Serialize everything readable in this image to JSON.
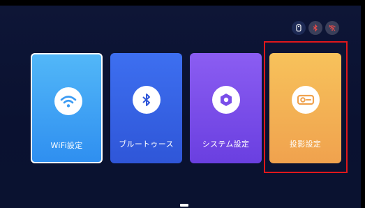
{
  "status_icons": [
    {
      "name": "usb-icon"
    },
    {
      "name": "bluetooth-off-icon"
    },
    {
      "name": "wifi-off-icon"
    }
  ],
  "menu": {
    "items": [
      {
        "label": "WiFi設定",
        "icon": "wifi-icon",
        "selected": true,
        "color": "#3fa2f5"
      },
      {
        "label": "ブルートゥース",
        "icon": "bluetooth-icon",
        "selected": false,
        "color": "#3563e6"
      },
      {
        "label": "システム設定",
        "icon": "hexagon-settings-icon",
        "selected": false,
        "color": "#7a4ee9"
      },
      {
        "label": "投影設定",
        "icon": "projector-icon",
        "selected": false,
        "color": "#f4b156"
      }
    ]
  },
  "colors": {
    "background": "#0c1330",
    "highlight_box": "#e0171b"
  }
}
